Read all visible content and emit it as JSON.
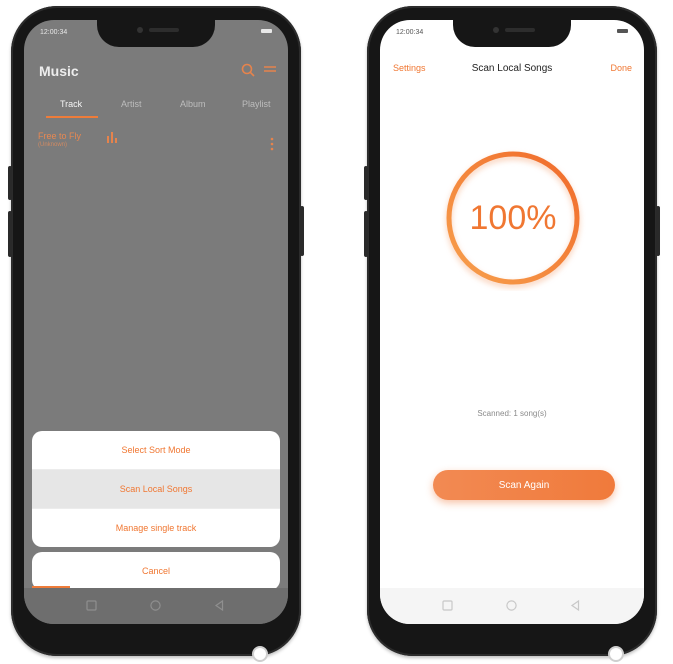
{
  "left_screen": {
    "status_time": "12:00:34",
    "app_title": "Music",
    "tabs": [
      {
        "label": "Track",
        "active": true
      },
      {
        "label": "Artist",
        "active": false
      },
      {
        "label": "Album",
        "active": false
      },
      {
        "label": "Playlist",
        "active": false
      }
    ],
    "track": {
      "title": "Free to Fly",
      "subtitle": "(Unknown)"
    },
    "sheet_items": [
      "Select Sort Mode",
      "Scan Local Songs",
      "Manage single track"
    ],
    "cancel_label": "Cancel",
    "colors": {
      "accent": "#f07732",
      "dim_overlay": "#7b7b7b"
    }
  },
  "right_screen": {
    "status_time": "12:00:34",
    "settings_label": "Settings",
    "title": "Scan Local Songs",
    "done_label": "Done",
    "progress_text": "100%",
    "progress_value": 1.0,
    "scanned_text": "Scanned: 1 song(s)",
    "scan_again_label": "Scan Again",
    "colors": {
      "accent": "#f07732",
      "ring_start": "#f7a04d",
      "ring_end": "#f06a2a"
    }
  },
  "icons": [
    "search-icon",
    "more-icon",
    "equalizer-icon",
    "track-more-icon",
    "nav-back-icon",
    "nav-home-icon",
    "nav-recent-icon"
  ]
}
